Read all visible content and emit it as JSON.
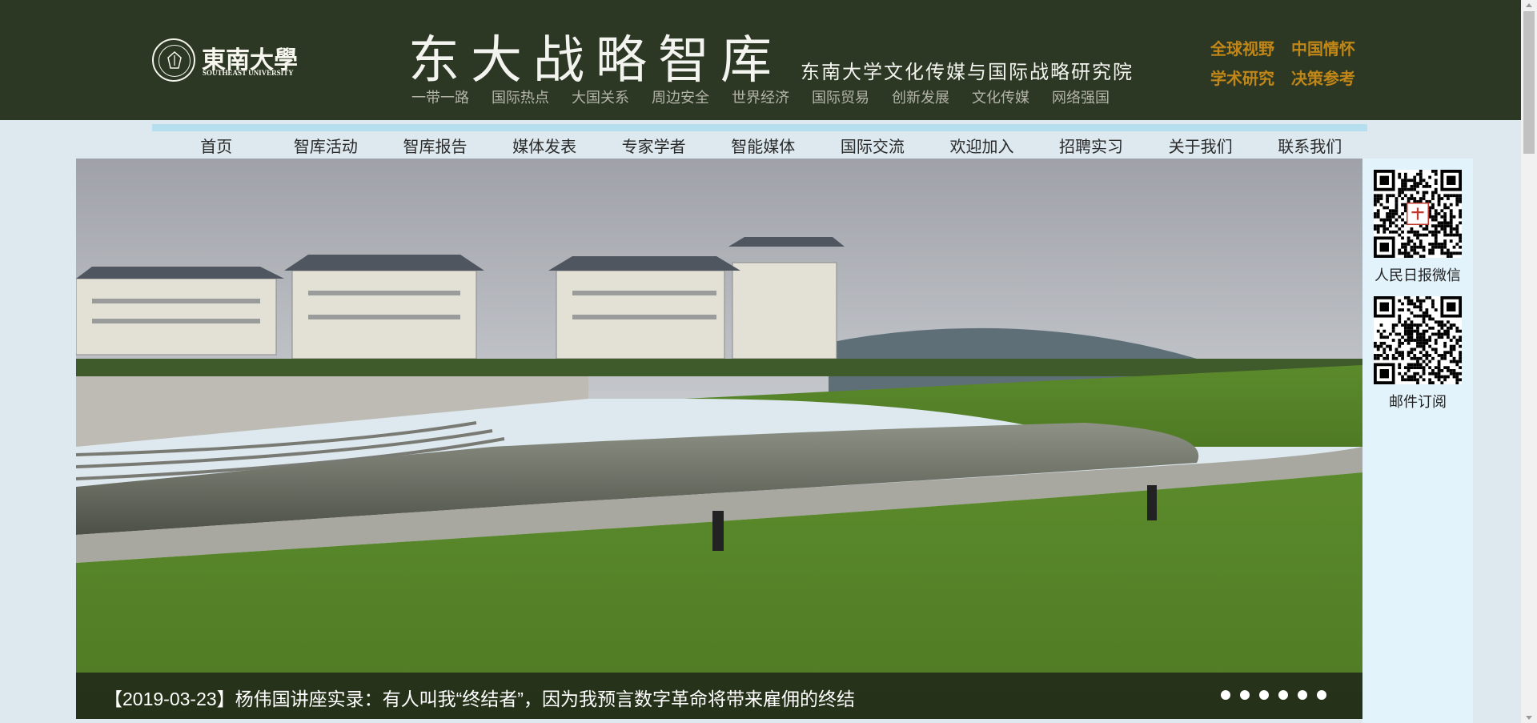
{
  "header": {
    "logo": {
      "cn": "東南大學",
      "en": "SOUTHEAST UNIVERSITY"
    },
    "title": "东大战略智库",
    "subtitle": "东南大学文化传媒与国际战略研究院",
    "topics": [
      "一带一路",
      "国际热点",
      "大国关系",
      "周边安全",
      "世界经济",
      "国际贸易",
      "创新发展",
      "文化传媒",
      "网络强国"
    ],
    "quick_links": {
      "row1": [
        "全球视野",
        "中国情怀"
      ],
      "row2": [
        "学术研究",
        "决策参考"
      ]
    }
  },
  "nav": {
    "items": [
      "首页",
      "智库活动",
      "智库报告",
      "媒体发表",
      "专家学者",
      "智能媒体",
      "国际交流",
      "欢迎加入",
      "招聘实习",
      "关于我们",
      "联系我们"
    ]
  },
  "banner": {
    "caption": "【2019-03-23】杨伟国讲座实录：有人叫我“终结者”，因为我预言数字革命将带来雇佣的终结",
    "slide_count": 6
  },
  "sidebar": {
    "qr1_label": "人民日报微信",
    "qr2_label": "邮件订阅"
  },
  "colors": {
    "header_bg": "#2c3823",
    "accent_gold": "#c08618",
    "nav_strip": "#b5dfee",
    "page_bg": "#dde9ef",
    "sidebar_bg": "#e2f3fb"
  }
}
